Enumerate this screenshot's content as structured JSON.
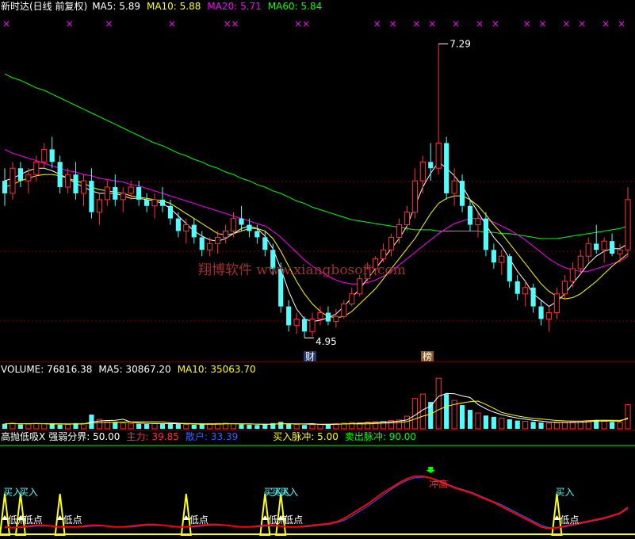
{
  "colors": {
    "up": "#ff3232",
    "down": "#54fcfc",
    "ma5": "#ffffff",
    "ma10": "#ffff00",
    "ma20": "#ff00ff",
    "ma60": "#00ff00",
    "grid": "#800000",
    "x_mark": "#ff00ff",
    "label_text": "#ffffff",
    "main_force": "#ff0000",
    "retail": "#3264ff",
    "zone": "#ffff00",
    "buy_text": "#54fcfc",
    "main_value": "#ff3232",
    "retail_value": "#3264ff",
    "buy_pulse_value": "#ffff00",
    "sell_pulse_value": "#00ff00",
    "threshold_line": "#00ff00"
  },
  "price_panel": {
    "title": "新时达(日线 前复权)",
    "ma_labels": [
      {
        "name": "MA5:",
        "value": "5.89",
        "color": "#ffffff"
      },
      {
        "name": "MA10:",
        "value": "5.88",
        "color": "#ffff00"
      },
      {
        "name": "MA20:",
        "value": "5.71",
        "color": "#ff00ff"
      },
      {
        "name": "MA60:",
        "value": "5.84",
        "color": "#00ff00"
      }
    ],
    "high_label": "7.29",
    "low_label": "4.95",
    "badge_cai": "财",
    "badge_bang": "榜",
    "watermark": "翔博软件 www.xiangbosoft.com",
    "x_marker": "×"
  },
  "volume_panel": {
    "labels": [
      {
        "name": "VOLUME:",
        "value": "76816.38",
        "color": "#ffffff"
      },
      {
        "name": "MA5:",
        "value": "30867.20",
        "color": "#ffffff"
      },
      {
        "name": "MA10:",
        "value": "35063.70",
        "color": "#ffff00"
      }
    ]
  },
  "indicator_panel": {
    "title": "高抛低吸X",
    "strength_label": "强弱分界:",
    "strength_value": "50.00",
    "main_label": "主力:",
    "main_value": "39.85",
    "retail_label": "散户:",
    "retail_value": "33.39",
    "buy_pulse_label": "买入脉冲:",
    "buy_pulse_value": "5.00",
    "sell_pulse_label": "卖出脉冲:",
    "sell_pulse_value": "90.00",
    "buy_text": "买入",
    "low_text": "低点",
    "high_text": "冲高"
  },
  "chart_data": {
    "type": "candlestick",
    "price_axis_range": [
      4.8,
      7.5
    ],
    "highest": 7.29,
    "lowest": 4.95,
    "candles": [
      [
        6.2,
        6.3,
        6.0,
        6.1
      ],
      [
        6.1,
        6.35,
        6.05,
        6.3
      ],
      [
        6.3,
        6.35,
        6.15,
        6.2
      ],
      [
        6.2,
        6.3,
        6.1,
        6.25
      ],
      [
        6.25,
        6.4,
        6.2,
        6.35
      ],
      [
        6.35,
        6.5,
        6.3,
        6.45
      ],
      [
        6.45,
        6.55,
        6.3,
        6.35
      ],
      [
        6.35,
        6.4,
        6.1,
        6.15
      ],
      [
        6.15,
        6.3,
        6.1,
        6.25
      ],
      [
        6.25,
        6.35,
        6.05,
        6.1
      ],
      [
        6.1,
        6.25,
        6.0,
        6.2
      ],
      [
        6.2,
        6.3,
        5.9,
        5.95
      ],
      [
        5.95,
        6.1,
        5.85,
        6.05
      ],
      [
        6.05,
        6.2,
        6.0,
        6.15
      ],
      [
        6.15,
        6.25,
        6.0,
        6.05
      ],
      [
        6.05,
        6.15,
        5.95,
        6.1
      ],
      [
        6.1,
        6.2,
        6.05,
        6.15
      ],
      [
        6.15,
        6.2,
        6.0,
        6.05
      ],
      [
        6.05,
        6.1,
        5.95,
        6.0
      ],
      [
        6.0,
        6.1,
        5.9,
        6.05
      ],
      [
        6.05,
        6.15,
        5.95,
        6.0
      ],
      [
        6.0,
        6.05,
        5.85,
        5.9
      ],
      [
        5.9,
        5.95,
        5.75,
        5.8
      ],
      [
        5.8,
        5.9,
        5.7,
        5.85
      ],
      [
        5.85,
        5.9,
        5.7,
        5.75
      ],
      [
        5.75,
        5.8,
        5.6,
        5.65
      ],
      [
        5.65,
        5.75,
        5.6,
        5.7
      ],
      [
        5.7,
        5.8,
        5.62,
        5.75
      ],
      [
        5.75,
        5.85,
        5.7,
        5.8
      ],
      [
        5.8,
        5.95,
        5.75,
        5.9
      ],
      [
        5.9,
        6.0,
        5.8,
        5.85
      ],
      [
        5.85,
        5.9,
        5.75,
        5.8
      ],
      [
        5.8,
        5.85,
        5.7,
        5.75
      ],
      [
        5.75,
        5.8,
        5.6,
        5.65
      ],
      [
        5.65,
        5.7,
        5.45,
        5.5
      ],
      [
        5.5,
        5.55,
        5.15,
        5.2
      ],
      [
        5.2,
        5.25,
        5.0,
        5.05
      ],
      [
        5.05,
        5.15,
        4.98,
        5.1
      ],
      [
        5.1,
        5.12,
        4.95,
        5.0
      ],
      [
        5.0,
        5.15,
        4.96,
        5.1
      ],
      [
        5.1,
        5.2,
        5.05,
        5.15
      ],
      [
        5.15,
        5.2,
        5.05,
        5.08
      ],
      [
        5.08,
        5.18,
        5.03,
        5.12
      ],
      [
        5.12,
        5.25,
        5.1,
        5.22
      ],
      [
        5.22,
        5.35,
        5.2,
        5.3
      ],
      [
        5.3,
        5.45,
        5.28,
        5.42
      ],
      [
        5.42,
        5.55,
        5.4,
        5.5
      ],
      [
        5.5,
        5.6,
        5.45,
        5.58
      ],
      [
        5.58,
        5.7,
        5.55,
        5.65
      ],
      [
        5.65,
        5.78,
        5.6,
        5.75
      ],
      [
        5.75,
        5.9,
        5.7,
        5.85
      ],
      [
        5.85,
        6.0,
        5.8,
        5.95
      ],
      [
        5.95,
        6.3,
        5.9,
        6.2
      ],
      [
        6.2,
        6.4,
        6.1,
        6.35
      ],
      [
        6.35,
        6.5,
        6.2,
        6.3
      ],
      [
        6.3,
        7.29,
        6.25,
        6.5
      ],
      [
        6.5,
        6.55,
        6.05,
        6.1
      ],
      [
        6.1,
        6.3,
        6.0,
        6.2
      ],
      [
        6.2,
        6.25,
        5.95,
        6.0
      ],
      [
        6.0,
        6.05,
        5.8,
        5.85
      ],
      [
        5.85,
        5.95,
        5.75,
        5.9
      ],
      [
        5.9,
        5.95,
        5.6,
        5.65
      ],
      [
        5.65,
        5.7,
        5.5,
        5.55
      ],
      [
        5.55,
        5.65,
        5.45,
        5.6
      ],
      [
        5.6,
        5.62,
        5.35,
        5.4
      ],
      [
        5.4,
        5.45,
        5.25,
        5.3
      ],
      [
        5.3,
        5.4,
        5.2,
        5.35
      ],
      [
        5.35,
        5.38,
        5.15,
        5.2
      ],
      [
        5.2,
        5.25,
        5.05,
        5.1
      ],
      [
        5.1,
        5.2,
        5.0,
        5.15
      ],
      [
        5.15,
        5.35,
        5.1,
        5.3
      ],
      [
        5.3,
        5.45,
        5.25,
        5.4
      ],
      [
        5.4,
        5.55,
        5.35,
        5.5
      ],
      [
        5.5,
        5.65,
        5.45,
        5.6
      ],
      [
        5.6,
        5.75,
        5.55,
        5.7
      ],
      [
        5.7,
        5.85,
        5.62,
        5.65
      ],
      [
        5.65,
        5.75,
        5.55,
        5.72
      ],
      [
        5.72,
        5.78,
        5.6,
        5.62
      ],
      [
        5.62,
        5.7,
        5.55,
        5.65
      ],
      [
        5.65,
        6.15,
        5.6,
        6.05
      ]
    ],
    "ma5": [
      6.2,
      6.22,
      6.25,
      6.28,
      6.3,
      6.3,
      6.28,
      6.25,
      6.22,
      6.18,
      6.15,
      6.12,
      6.1,
      6.1,
      6.1,
      6.08,
      6.06,
      6.06,
      6.05,
      6.04,
      6.02,
      5.98,
      5.92,
      5.86,
      5.8,
      5.76,
      5.73,
      5.72,
      5.74,
      5.78,
      5.82,
      5.84,
      5.82,
      5.76,
      5.66,
      5.5,
      5.32,
      5.18,
      5.1,
      5.08,
      5.09,
      5.11,
      5.14,
      5.2,
      5.27,
      5.34,
      5.42,
      5.5,
      5.58,
      5.66,
      5.74,
      5.84,
      6.0,
      6.15,
      6.26,
      6.35,
      6.3,
      6.24,
      6.16,
      6.05,
      5.95,
      5.85,
      5.75,
      5.68,
      5.58,
      5.48,
      5.4,
      5.3,
      5.25,
      5.2,
      5.24,
      5.3,
      5.38,
      5.46,
      5.54,
      5.6,
      5.64,
      5.66,
      5.66,
      5.7
    ],
    "ma10": [
      6.15,
      6.17,
      6.2,
      6.22,
      6.24,
      6.25,
      6.25,
      6.24,
      6.22,
      6.2,
      6.18,
      6.15,
      6.13,
      6.12,
      6.11,
      6.1,
      6.08,
      6.07,
      6.06,
      6.05,
      6.04,
      6.02,
      5.98,
      5.94,
      5.9,
      5.86,
      5.82,
      5.78,
      5.77,
      5.78,
      5.8,
      5.82,
      5.82,
      5.8,
      5.74,
      5.64,
      5.52,
      5.4,
      5.3,
      5.22,
      5.16,
      5.12,
      5.11,
      5.12,
      5.16,
      5.22,
      5.28,
      5.34,
      5.42,
      5.5,
      5.58,
      5.66,
      5.74,
      5.84,
      5.94,
      6.02,
      6.06,
      6.08,
      6.08,
      6.05,
      6.0,
      5.93,
      5.85,
      5.78,
      5.7,
      5.62,
      5.54,
      5.46,
      5.38,
      5.32,
      5.28,
      5.26,
      5.27,
      5.3,
      5.35,
      5.4,
      5.46,
      5.52,
      5.57,
      5.62
    ],
    "ma20": [
      6.45,
      6.42,
      6.4,
      6.38,
      6.36,
      6.34,
      6.32,
      6.3,
      6.28,
      6.27,
      6.25,
      6.24,
      6.22,
      6.21,
      6.2,
      6.19,
      6.17,
      6.16,
      6.14,
      6.12,
      6.1,
      6.08,
      6.06,
      6.04,
      6.02,
      6.0,
      5.98,
      5.96,
      5.94,
      5.92,
      5.9,
      5.88,
      5.86,
      5.84,
      5.8,
      5.75,
      5.69,
      5.63,
      5.57,
      5.52,
      5.48,
      5.44,
      5.41,
      5.39,
      5.38,
      5.38,
      5.39,
      5.41,
      5.44,
      5.48,
      5.53,
      5.58,
      5.63,
      5.68,
      5.73,
      5.78,
      5.82,
      5.86,
      5.88,
      5.9,
      5.9,
      5.89,
      5.87,
      5.84,
      5.81,
      5.77,
      5.73,
      5.68,
      5.63,
      5.58,
      5.54,
      5.51,
      5.49,
      5.48,
      5.48,
      5.5,
      5.52,
      5.54,
      5.56,
      5.6
    ],
    "ma60": [
      7.05,
      7.02,
      7.0,
      6.97,
      6.94,
      6.92,
      6.89,
      6.86,
      6.83,
      6.8,
      6.77,
      6.74,
      6.71,
      6.68,
      6.65,
      6.62,
      6.59,
      6.56,
      6.53,
      6.5,
      6.48,
      6.45,
      6.42,
      6.4,
      6.37,
      6.35,
      6.32,
      6.3,
      6.27,
      6.25,
      6.22,
      6.2,
      6.17,
      6.15,
      6.12,
      6.1,
      6.07,
      6.04,
      6.02,
      5.99,
      5.97,
      5.95,
      5.93,
      5.91,
      5.89,
      5.88,
      5.87,
      5.86,
      5.85,
      5.84,
      5.83,
      5.82,
      5.81,
      5.81,
      5.81,
      5.8,
      5.8,
      5.8,
      5.8,
      5.8,
      5.8,
      5.79,
      5.79,
      5.78,
      5.78,
      5.77,
      5.76,
      5.75,
      5.74,
      5.74,
      5.74,
      5.75,
      5.76,
      5.77,
      5.78,
      5.79,
      5.8,
      5.81,
      5.82,
      5.84
    ],
    "volume": [
      16000,
      18000,
      14000,
      15000,
      17000,
      16000,
      15000,
      13000,
      14000,
      18000,
      17000,
      45000,
      30000,
      22000,
      20000,
      18000,
      17000,
      16000,
      15000,
      17000,
      16000,
      18000,
      15000,
      14000,
      13000,
      14000,
      16000,
      17000,
      18000,
      16000,
      14000,
      13000,
      12000,
      15000,
      18000,
      22000,
      16000,
      14000,
      12000,
      13000,
      14000,
      15000,
      16000,
      18000,
      20000,
      19000,
      21000,
      22000,
      24000,
      26000,
      28000,
      40000,
      96000,
      110000,
      85000,
      160000,
      110000,
      90000,
      75000,
      60000,
      50000,
      42000,
      38000,
      34000,
      30000,
      26000,
      24000,
      22000,
      20000,
      18000,
      19000,
      21000,
      22000,
      24000,
      26000,
      28000,
      24000,
      22000,
      20000,
      76816
    ],
    "volume_ma5": [
      16000,
      16500,
      16000,
      16200,
      16600,
      16000,
      15400,
      15000,
      15000,
      15200,
      15400,
      21400,
      24800,
      26400,
      26800,
      30400,
      21400,
      18600,
      17200,
      16600,
      16200,
      16400,
      16200,
      16000,
      15200,
      14800,
      14400,
      14800,
      15600,
      16200,
      15800,
      15600,
      14600,
      14000,
      14400,
      16400,
      16400,
      15800,
      15600,
      16600,
      13800,
      13600,
      14000,
      15200,
      16600,
      17600,
      18800,
      20000,
      21200,
      22400,
      24200,
      28000,
      42800,
      60000,
      71800,
      102200,
      112200,
      111000,
      104000,
      99000,
      77000,
      63400,
      53000,
      44800,
      38800,
      34000,
      30400,
      27200,
      24400,
      22000,
      20600,
      20000,
      20000,
      20800,
      22400,
      24200,
      24800,
      24800,
      24000,
      34163
    ],
    "volume_ma10": [
      16000,
      16250,
      16000,
      16000,
      16200,
      16300,
      16200,
      16000,
      15800,
      15600,
      15700,
      18200,
      19900,
      20800,
      21000,
      21400,
      21900,
      22200,
      22300,
      22200,
      21800,
      19400,
      17900,
      17100,
      16500,
      16100,
      16000,
      16000,
      16100,
      16100,
      15900,
      15500,
      15000,
      14800,
      15000,
      15700,
      15700,
      15400,
      14800,
      14500,
      14500,
      14800,
      15100,
      15400,
      15600,
      15300,
      15800,
      16600,
      17800,
      18900,
      20300,
      22800,
      30800,
      40000,
      46400,
      60800,
      70400,
      77200,
      82300,
      85700,
      87700,
      77300,
      64600,
      52000,
      46000,
      40600,
      36400,
      33400,
      31000,
      28800,
      26300,
      25200,
      24500,
      24300,
      25400,
      27200,
      27400,
      27000,
      26500,
      31400
    ],
    "indicator_range": [
      0,
      100
    ],
    "main_force": [
      10,
      9,
      10,
      11,
      12,
      12,
      11,
      10,
      10,
      10,
      11,
      12,
      12,
      11,
      10,
      10,
      11,
      12,
      13,
      13,
      12,
      11,
      10,
      10,
      11,
      12,
      13,
      13,
      12,
      11,
      10,
      10,
      11,
      12,
      12,
      11,
      10,
      10,
      11,
      12,
      13,
      14,
      16,
      20,
      26,
      32,
      38,
      45,
      52,
      58,
      64,
      69,
      72,
      72,
      70,
      66,
      62,
      58,
      55,
      52,
      48,
      44,
      40,
      35,
      30,
      25,
      20,
      15,
      10,
      8,
      9,
      11,
      13,
      15,
      17,
      19,
      21,
      24,
      27,
      34
    ],
    "retail": [
      9,
      9,
      9,
      10,
      11,
      11,
      11,
      10,
      10,
      10,
      10,
      11,
      11,
      11,
      10,
      10,
      10,
      11,
      12,
      12,
      12,
      11,
      10,
      10,
      10,
      11,
      12,
      12,
      12,
      11,
      10,
      10,
      10,
      11,
      11,
      11,
      10,
      10,
      10,
      11,
      12,
      13,
      15,
      18,
      23,
      29,
      35,
      42,
      49,
      56,
      62,
      67,
      70,
      71,
      70,
      67,
      63,
      59,
      56,
      53,
      49,
      45,
      41,
      37,
      32,
      27,
      22,
      17,
      12,
      9,
      9,
      10,
      12,
      14,
      16,
      18,
      20,
      23,
      26,
      32
    ],
    "buy_signal_x": [
      0,
      2,
      33,
      34,
      35,
      70
    ],
    "low_signal_x": [
      0,
      2,
      7,
      23,
      33,
      35,
      70
    ],
    "high_signal_x": [
      54
    ]
  }
}
